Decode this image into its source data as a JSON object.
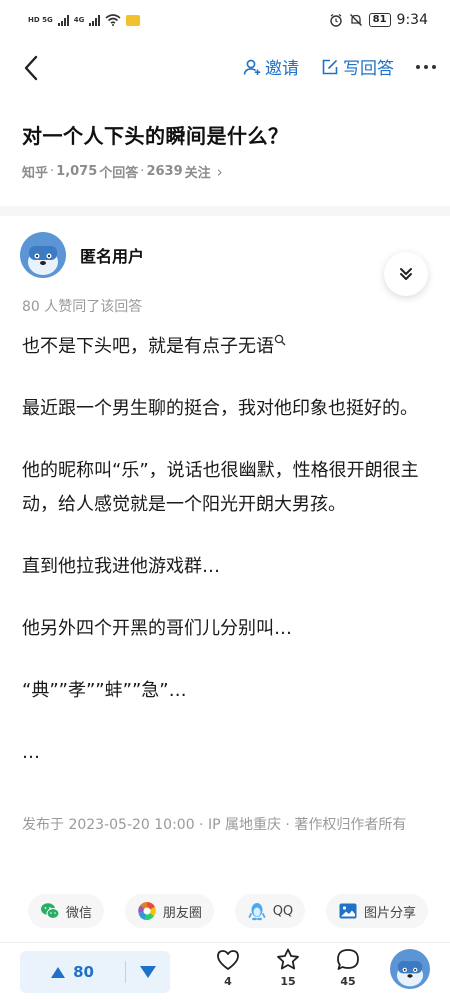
{
  "status_bar": {
    "sig1_tag": "HD 5G",
    "sig2_tag": "4G",
    "battery": "81",
    "time": "9:34"
  },
  "nav": {
    "invite_label": "邀请",
    "write_answer_label": "写回答"
  },
  "question": {
    "title": "对一个人下头的瞬间是什么？",
    "source": "知乎",
    "answers_count": "1,075",
    "answers_label": "个回答",
    "followers_count": "2639",
    "followers_label": "关注",
    "sep": "·",
    "chevron": "›"
  },
  "author": {
    "name": "匿名用户"
  },
  "upvote_note": "80 人赞同了该回答",
  "answer": {
    "paragraphs": [
      "也不是下头吧，就是有点子无语",
      "最近跟一个男生聊的挺合，我对他印象也挺好的。",
      "他的昵称叫“乐”，说话也很幽默，性格很开朗很主动，给人感觉就是一个阳光开朗大男孩。",
      "直到他拉我进他游戏群…",
      "他另外四个开黑的哥们儿分别叫…",
      "“典””孝””蚌””急”…",
      "…"
    ]
  },
  "publish_info": "发布于 2023-05-20 10:00 · IP 属地重庆 · 著作权归作者所有",
  "share": {
    "wechat": "微信",
    "moments": "朋友圈",
    "qq": "QQ",
    "image_share": "图片分享"
  },
  "bottom_bar": {
    "upvote_count": "80",
    "like_count": "4",
    "favorite_count": "15",
    "comment_count": "45"
  },
  "colors": {
    "accent": "#1e72c7",
    "wechat_green": "#2aae67",
    "qq_blue": "#4fa8ee",
    "avatar_bg": "#5b95d6"
  }
}
